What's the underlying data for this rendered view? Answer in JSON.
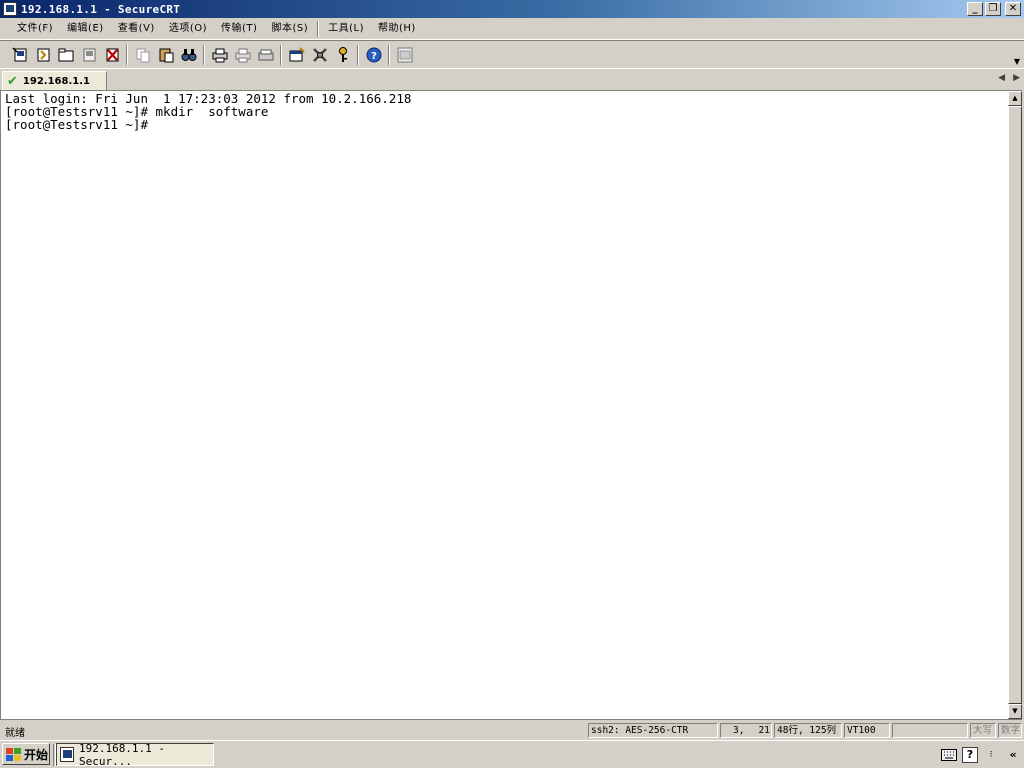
{
  "window": {
    "title": "192.168.1.1 - SecureCRT"
  },
  "menu": {
    "file": "文件(F)",
    "edit": "编辑(E)",
    "view": "查看(V)",
    "options": "选项(O)",
    "transfer": "传输(T)",
    "script": "脚本(S)",
    "tools": "工具(L)",
    "help": "帮助(H)"
  },
  "toolbar": {
    "icons": [
      "connect-icon",
      "quick-connect-icon",
      "connect-in-tab-icon",
      "reconnect-icon",
      "disconnect-icon",
      "copy-icon",
      "paste-icon",
      "find-icon",
      "print-icon",
      "print-selection-icon",
      "print-setup-icon",
      "session-options-icon",
      "global-options-icon",
      "keymap-icon",
      "help-icon",
      "sftp-icon"
    ]
  },
  "tab": {
    "label": "192.168.1.1",
    "status": "connected"
  },
  "terminal": {
    "lines": [
      "Last login: Fri Jun  1 17:23:03 2012 from 10.2.166.218",
      "[root@Testsrv11 ~]# mkdir  software",
      "[root@Testsrv11 ~]#"
    ]
  },
  "statusbar": {
    "ready": "就绪",
    "cipher": "ssh2: AES-256-CTR",
    "position_row": "3,",
    "position_col": "21",
    "size": "48行, 125列",
    "emulation": "VT100",
    "blank": "",
    "caps": "大写",
    "num": "数字"
  },
  "taskbar": {
    "start_label": "开始",
    "task_label": "192.168.1.1 - Secur..."
  },
  "colors": {
    "title_gradient_start": "#0a246a",
    "title_gradient_end": "#a6caf0",
    "chrome": "#d4d0c8",
    "connected_check": "#3a9a2a"
  }
}
